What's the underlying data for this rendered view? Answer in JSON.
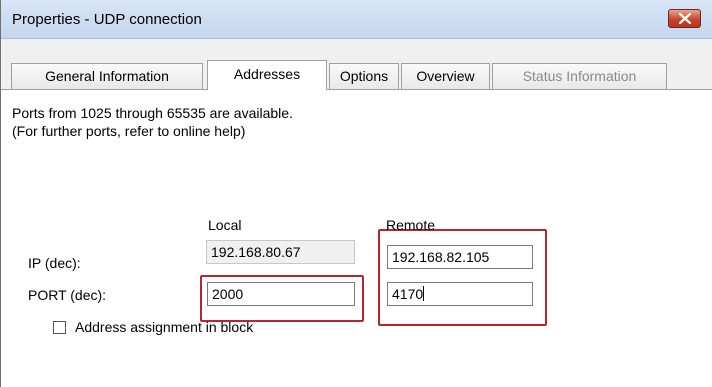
{
  "window": {
    "title": "Properties - UDP connection"
  },
  "tabs": [
    {
      "label": "General Information",
      "state": "normal"
    },
    {
      "label": "Addresses",
      "state": "active"
    },
    {
      "label": "Options",
      "state": "normal"
    },
    {
      "label": "Overview",
      "state": "normal"
    },
    {
      "label": "Status Information",
      "state": "disabled"
    }
  ],
  "addresses": {
    "info_line1": "Ports from 1025 through 65535 are available.",
    "info_line2": "(For further ports, refer to online help)",
    "col_local": "Local",
    "col_remote": "Remote",
    "ip_label": "IP (dec):",
    "port_label": "PORT (dec):",
    "local_ip": "192.168.80.67",
    "remote_ip": "192.168.82.105",
    "local_port": "2000",
    "remote_port": "4170",
    "checkbox_label": "Address assignment in block",
    "checkbox_checked": false
  },
  "colors": {
    "highlight": "#b5262e",
    "close_button": "#c7452c"
  }
}
